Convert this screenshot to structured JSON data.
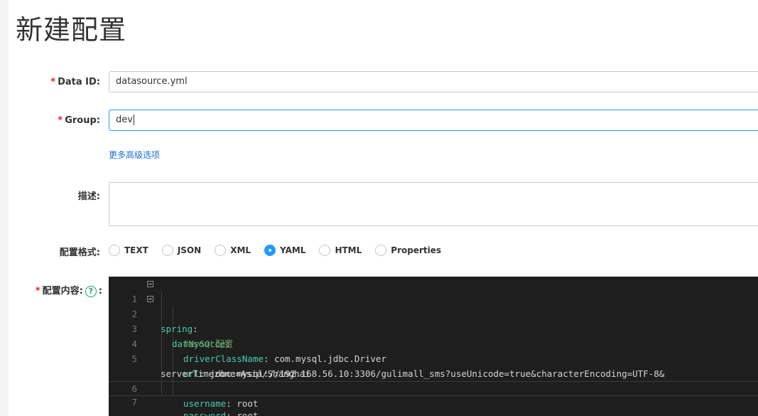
{
  "page": {
    "title": "新建配置"
  },
  "form": {
    "data_id": {
      "label": "Data ID:",
      "required_mark": "*",
      "value": "datasource.yml"
    },
    "group": {
      "label": "Group:",
      "required_mark": "*",
      "value": "dev"
    },
    "more_options_link": "更多高级选项",
    "description": {
      "label": "描述:",
      "value": ""
    },
    "format": {
      "label": "配置格式:",
      "selected": "YAML",
      "options": [
        {
          "label": "TEXT",
          "checked": false
        },
        {
          "label": "JSON",
          "checked": false
        },
        {
          "label": "XML",
          "checked": false
        },
        {
          "label": "YAML",
          "checked": true
        },
        {
          "label": "HTML",
          "checked": false
        },
        {
          "label": "Properties",
          "checked": false
        }
      ]
    },
    "content": {
      "label": "配置内容:",
      "required_mark": "*",
      "help_icon": "?",
      "colon": ":",
      "lines": [
        {
          "num": "1",
          "fold": true,
          "key": "spring",
          "sep": ":",
          "value": ""
        },
        {
          "num": "2",
          "fold": true,
          "key": "datasource",
          "sep": ":",
          "value": ""
        },
        {
          "num": "3",
          "fold": false,
          "comment": "#MySQL配置"
        },
        {
          "num": "4",
          "fold": false,
          "key": "driverClassName",
          "sep": ":",
          "value": " com.mysql.jdbc.Driver"
        },
        {
          "num": "5",
          "fold": false,
          "key": "url",
          "sep": ":",
          "value": " jdbc:mysql://192.168.56.10:3306/gulimall_sms?useUnicode=true&characterEncoding=UTF-8&",
          "continuation": "serverTimezone=Asia/Shanghai"
        },
        {
          "num": "6",
          "fold": false,
          "key": "username",
          "sep": ":",
          "value": " root"
        },
        {
          "num": "7",
          "fold": false,
          "key": "password",
          "sep": ":",
          "value": " root"
        }
      ]
    }
  },
  "colors": {
    "required": "#e5242b",
    "link": "#1a6fd2",
    "focus_border": "#209bfa",
    "editor_bg": "#1e1e1e",
    "yaml_key": "#4ec9b0",
    "comment": "#6a9955",
    "help_icon": "#1aa561"
  }
}
